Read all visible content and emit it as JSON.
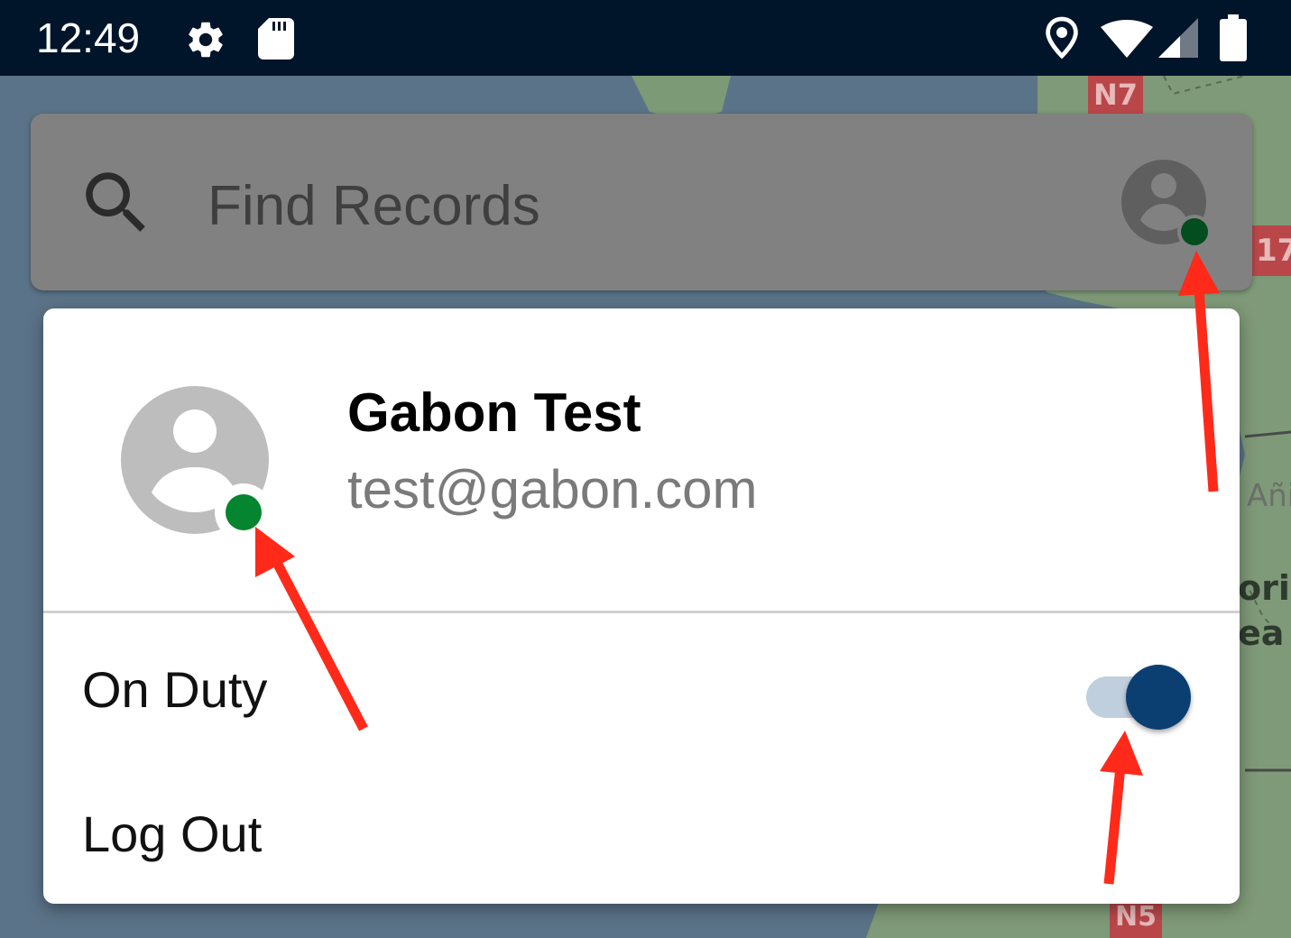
{
  "status_bar": {
    "time": "12:49",
    "icons": [
      "gear-icon",
      "sd-card-icon",
      "location-icon",
      "wifi-icon",
      "signal-icon",
      "battery-icon"
    ]
  },
  "map": {
    "road_labels": [
      "N7",
      "17",
      "N5"
    ],
    "place_labels": [
      "Añi",
      "oria",
      "ea"
    ]
  },
  "search": {
    "placeholder": "Find Records",
    "icon": "search-icon",
    "account_icon": "account-circle-icon",
    "status": "on-duty"
  },
  "account_menu": {
    "user_name": "Gabon Test",
    "user_email": "test@gabon.com",
    "avatar_icon": "account-circle-icon",
    "status": "on-duty",
    "items": [
      {
        "label": "On Duty",
        "toggle": true
      },
      {
        "label": "Log Out"
      }
    ]
  },
  "colors": {
    "status_bar": "#00142a",
    "search_bar_dimmed": "#818181",
    "status_dot_online": "#05852f",
    "toggle_thumb": "#0b3f72",
    "toggle_track": "#bfcfdd",
    "annotation_arrow": "#ff2a1a"
  }
}
